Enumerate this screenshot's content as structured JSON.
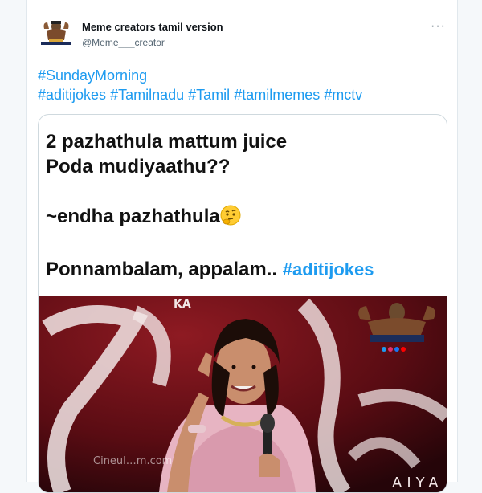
{
  "tweet": {
    "author_name": "Meme creators tamil version",
    "author_handle": "@Meme___creator",
    "more_label": "···",
    "hashtag_line1": [
      "#SundayMorning"
    ],
    "hashtag_line2": [
      "#aditijokes",
      "#Tamilnadu",
      "#Tamil",
      "#tamilmemes",
      "#mctv"
    ]
  },
  "meme": {
    "line1": "2 pazhathula mattum juice",
    "line2": "Poda mudiyaathu??",
    "line3": "~endha pazhathula",
    "line3_emoji": "thinking-face",
    "line4": "Ponnambalam, appalam..",
    "line4_hashtag": "#aditijokes",
    "photo_watermark": "Cineul…m.com",
    "backdrop_letters": [
      "KA",
      "AIYA"
    ]
  },
  "colors": {
    "link": "#1d9bf0",
    "text": "#0f1419",
    "muted": "#536471",
    "stage_red": "#7a0f16"
  }
}
